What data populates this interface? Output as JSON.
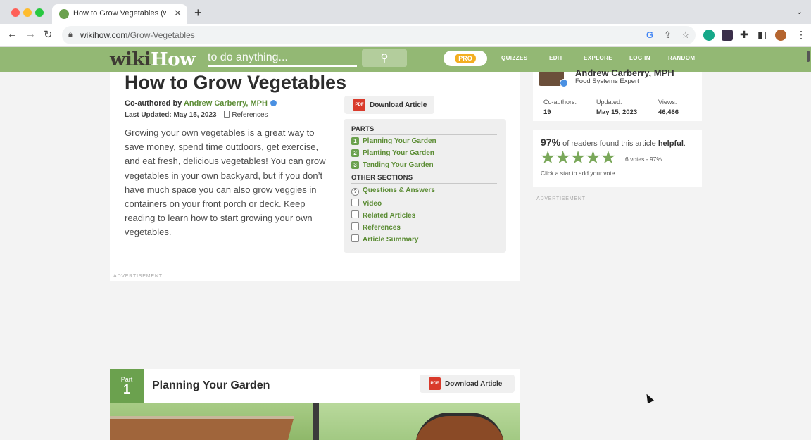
{
  "browser": {
    "tab_title": "How to Grow Vegetables (with Pictures) - wikiHow",
    "tab_close": "✕",
    "new_tab": "+",
    "url_host": "wikihow.com",
    "url_path": "/Grow-Vegetables"
  },
  "site": {
    "logo_wiki": "wiki",
    "logo_how": "How",
    "search_placeholder": "to do anything...",
    "pro_label": "PRO",
    "nav": [
      "QUIZZES",
      "EDIT",
      "EXPLORE",
      "LOG IN",
      "RANDOM"
    ]
  },
  "article": {
    "title": "How to Grow Vegetables",
    "coauthored_prefix": "Co-authored by ",
    "author": "Andrew Carberry, MPH",
    "last_updated": "Last Updated: May 15, 2023",
    "references_label": "References",
    "intro": "Growing your own vegetables is a great way to save money, spend time outdoors, get exercise, and eat fresh, delicious vegetables! You can grow vegetables in your own backyard, but if you don’t have much space you can also grow veggies in containers on your front porch or deck. Keep reading to learn how to start growing your own vegetables.",
    "download_label": "Download Article",
    "pdf_label": "PDF",
    "advertisement_label": "ADVERTISEMENT"
  },
  "toc": {
    "parts_heading": "PARTS",
    "parts": [
      {
        "num": "1",
        "label": "Planning Your Garden"
      },
      {
        "num": "2",
        "label": "Planting Your Garden"
      },
      {
        "num": "3",
        "label": "Tending Your Garden"
      }
    ],
    "other_heading": "OTHER SECTIONS",
    "other": [
      {
        "icon": "?",
        "label": "Questions & Answers"
      },
      {
        "icon": "",
        "label": "Video"
      },
      {
        "icon": "",
        "label": "Related Articles"
      },
      {
        "icon": "",
        "label": "References"
      },
      {
        "icon": "",
        "label": "Article Summary"
      }
    ]
  },
  "sidebar": {
    "author_name": "Andrew Carberry, MPH",
    "author_role": "Food Systems Expert",
    "stats": [
      {
        "label": "Co-authors:",
        "value": "19"
      },
      {
        "label": "Updated:",
        "value": "May 15, 2023"
      },
      {
        "label": "Views:",
        "value": "46,466"
      }
    ],
    "helpful_pct": "97%",
    "helpful_text_pre": " of readers found this article ",
    "helpful_word": "helpful",
    "helpful_end": ".",
    "stars_filled": 5,
    "star_glyph": "★",
    "votes": "6 votes - 97%",
    "click_star": "Click a star to add your vote",
    "advertisement_label": "ADVERTISEMENT"
  },
  "part1": {
    "part_word": "Part",
    "part_num": "1",
    "title": "Planning Your Garden",
    "download_label": "Download Article",
    "pdf_label": "PDF"
  },
  "colors": {
    "brand_green": "#93b874",
    "link_green": "#5b8c34",
    "pro_orange": "#f3ae21",
    "star_green": "#7aa85a"
  }
}
